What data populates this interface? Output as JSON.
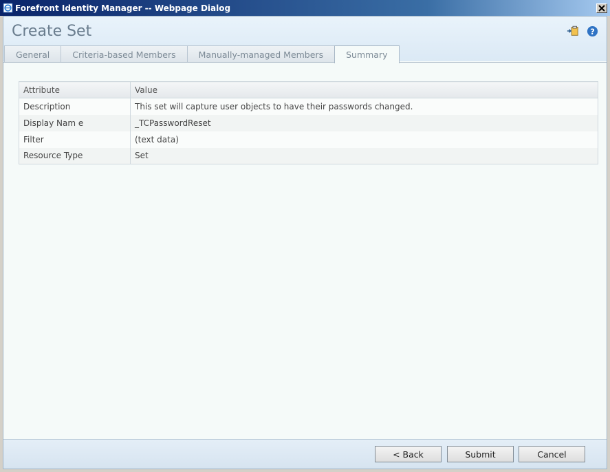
{
  "window": {
    "title": "Forefront Identity Manager -- Webpage Dialog",
    "close_glyph": "✕"
  },
  "header": {
    "title": "Create Set",
    "icons": [
      "add-to-clipboard-icon",
      "help-icon"
    ]
  },
  "tabs": [
    {
      "label": "General",
      "active": false
    },
    {
      "label": "Criteria-based Members",
      "active": false
    },
    {
      "label": "Manually-managed Members",
      "active": false
    },
    {
      "label": "Summary",
      "active": true
    }
  ],
  "summary": {
    "columns": [
      "Attribute",
      "Value"
    ],
    "rows": [
      {
        "attribute": "Description",
        "value": "This set will capture user objects to have their passwords changed."
      },
      {
        "attribute": "Display Nam e",
        "value": "_TCPasswordReset"
      },
      {
        "attribute": "Filter",
        "value": "(text data)"
      },
      {
        "attribute": "Resource Type",
        "value": "Set"
      }
    ]
  },
  "footer": {
    "back_label": "< Back",
    "submit_label": "Submit",
    "cancel_label": "Cancel"
  }
}
